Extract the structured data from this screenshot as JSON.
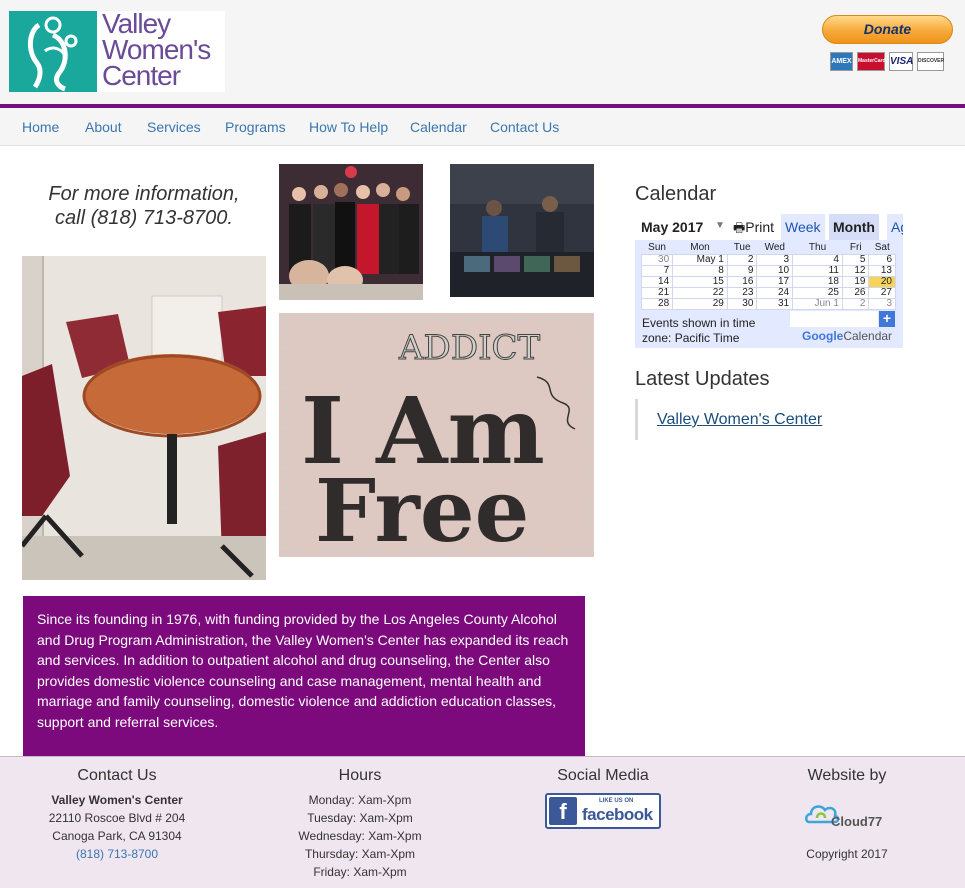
{
  "header": {
    "logo_line1": "Valley",
    "logo_line2": "Women's",
    "logo_line3": "Center",
    "donate_label": "Donate",
    "cards": [
      "AMEX",
      "MasterCard",
      "VISA",
      "DISCOVER"
    ]
  },
  "nav": {
    "items": [
      {
        "label": "Home"
      },
      {
        "label": "About"
      },
      {
        "label": "Services"
      },
      {
        "label": "Programs"
      },
      {
        "label": "How To Help"
      },
      {
        "label": "Calendar"
      },
      {
        "label": "Contact Us"
      }
    ]
  },
  "main": {
    "info_line1": "For more information,",
    "info_line2": "call (818) 713-8700.",
    "about_text": "Since its founding in 1976, with funding provided by the Los Angeles County Alcohol and Drug Program Administration, the Valley Women's Center has expanded its reach and services. In addition to outpatient alcohol and drug counseling, the Center also provides domestic violence counseling and case management, mental health and marriage and family counseling, domestic violence and addiction education classes, support and referral services."
  },
  "sidebar": {
    "calendar_heading": "Calendar",
    "calendar": {
      "month_label": "May 2017",
      "print_label": "Print",
      "tabs": [
        "Week",
        "Month",
        "Ag"
      ],
      "weekdays": [
        "Sun",
        "Mon",
        "Tue",
        "Wed",
        "Thu",
        "Fri",
        "Sat"
      ],
      "weeks": [
        [
          "30",
          "May 1",
          "2",
          "3",
          "4",
          "5",
          "6"
        ],
        [
          "7",
          "8",
          "9",
          "10",
          "11",
          "12",
          "13"
        ],
        [
          "14",
          "15",
          "16",
          "17",
          "18",
          "19",
          "20"
        ],
        [
          "21",
          "22",
          "23",
          "24",
          "25",
          "26",
          "27"
        ],
        [
          "28",
          "29",
          "30",
          "31",
          "Jun 1",
          "2",
          "3"
        ]
      ],
      "timezone_line1": "Events shown in time",
      "timezone_line2": "zone: Pacific Time",
      "google_word": "Google",
      "google_calendar": "Calendar",
      "plus_label": "+"
    },
    "updates_heading": "Latest Updates",
    "updates_link": "Valley Women's Center"
  },
  "footer": {
    "contact": {
      "heading": "Contact Us",
      "name": "Valley Women's Center",
      "address1": "22110 Roscoe Blvd # 204",
      "address2": "Canoga Park, CA 91304",
      "phone": "(818) 713-8700"
    },
    "hours": {
      "heading": "Hours",
      "lines": [
        "Monday: Xam-Xpm",
        "Tuesday: Xam-Xpm",
        "Wednesday: Xam-Xpm",
        "Thursday: Xam-Xpm",
        "Friday: Xam-Xpm"
      ]
    },
    "social": {
      "heading": "Social Media",
      "fb_small": "LIKE US ON",
      "fb_big": "facebook",
      "fb_f": "f"
    },
    "website_by": {
      "heading": "Website by",
      "brand": "Cloud77",
      "copyright": "Copyright 2017"
    }
  },
  "colors": {
    "purple": "#7c0a7c",
    "teal": "#19a89b",
    "link": "#3a76b0",
    "footer_bg": "#f0e6f0"
  }
}
